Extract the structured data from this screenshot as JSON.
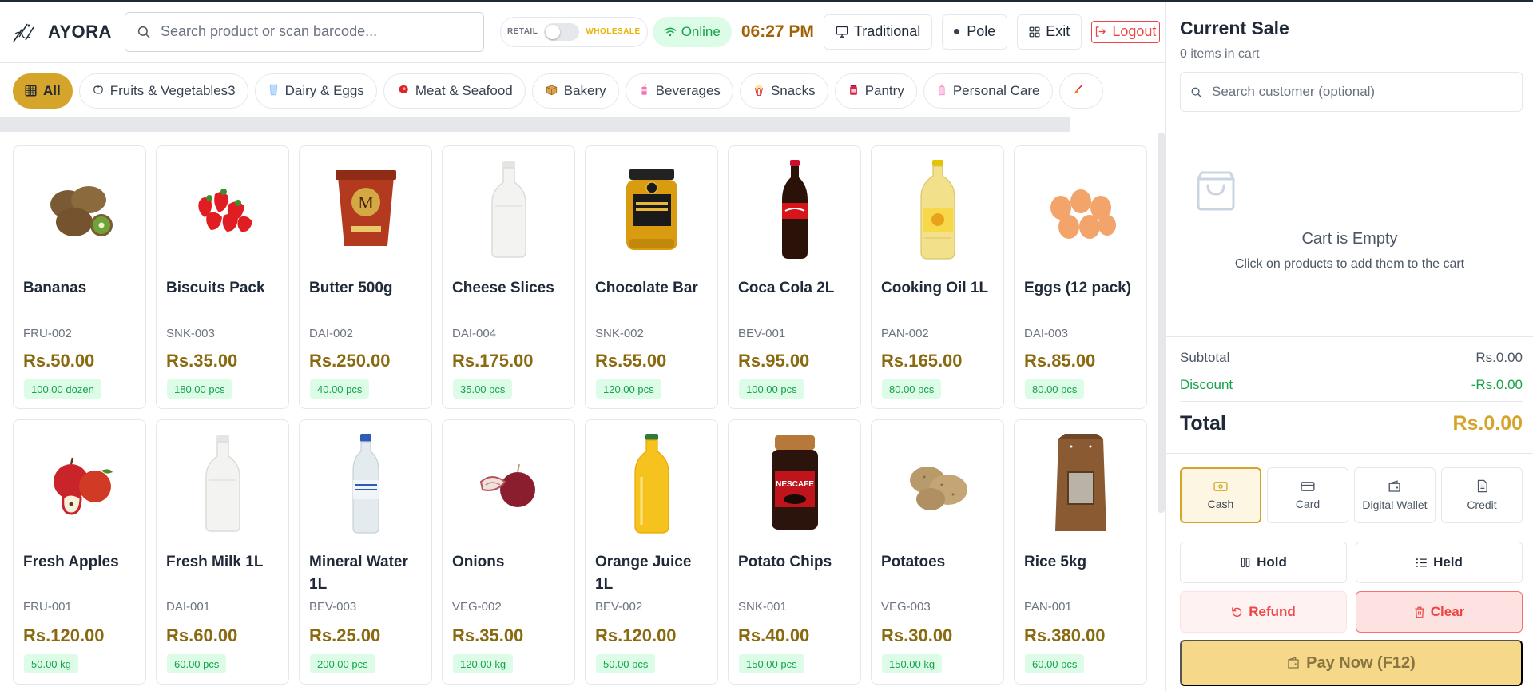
{
  "app": {
    "brand": "AYORA"
  },
  "header": {
    "search_placeholder": "Search product or scan barcode...",
    "mode_retail": "RETAIL",
    "mode_wholesale": "WHOLESALE",
    "status": "Online",
    "time": "06:27 PM",
    "btn_traditional": "Traditional",
    "btn_pole": "Pole",
    "btn_exit": "Exit",
    "btn_logout": "Logout"
  },
  "categories": [
    {
      "label": "All",
      "icon": "grid-icon",
      "active": true
    },
    {
      "label": "Fruits & Vegetables3",
      "icon": "apple-icon"
    },
    {
      "label": "Dairy & Eggs",
      "icon": "cup-icon"
    },
    {
      "label": "Meat & Seafood",
      "icon": "meat-icon"
    },
    {
      "label": "Bakery",
      "icon": "box-icon"
    },
    {
      "label": "Beverages",
      "icon": "drink-icon"
    },
    {
      "label": "Snacks",
      "icon": "popcorn-icon"
    },
    {
      "label": "Pantry",
      "icon": "jar-icon"
    },
    {
      "label": "Personal Care",
      "icon": "bottle-icon"
    }
  ],
  "products": [
    {
      "name": "Bananas",
      "sku": "FRU-002",
      "price": "Rs.50.00",
      "stock": "100.00 dozen",
      "image": "kiwi-image"
    },
    {
      "name": "Biscuits Pack",
      "sku": "SNK-003",
      "price": "Rs.35.00",
      "stock": "180.00 pcs",
      "image": "strawberries-image"
    },
    {
      "name": "Butter 500g",
      "sku": "DAI-002",
      "price": "Rs.250.00",
      "stock": "40.00 pcs",
      "image": "ice-cream-tub-image"
    },
    {
      "name": "Cheese Slices",
      "sku": "DAI-004",
      "price": "Rs.175.00",
      "stock": "35.00 pcs",
      "image": "milk-bottle-image"
    },
    {
      "name": "Chocolate Bar",
      "sku": "SNK-002",
      "price": "Rs.55.00",
      "stock": "120.00 pcs",
      "image": "honey-jar-image"
    },
    {
      "name": "Coca Cola 2L",
      "sku": "BEV-001",
      "price": "Rs.95.00",
      "stock": "100.00 pcs",
      "image": "cola-bottle-image"
    },
    {
      "name": "Cooking Oil 1L",
      "sku": "PAN-002",
      "price": "Rs.165.00",
      "stock": "80.00 pcs",
      "image": "oil-bottle-image"
    },
    {
      "name": "Eggs (12 pack)",
      "sku": "DAI-003",
      "price": "Rs.85.00",
      "stock": "80.00 pcs",
      "image": "eggs-image"
    },
    {
      "name": "Fresh Apples",
      "sku": "FRU-001",
      "price": "Rs.120.00",
      "stock": "50.00 kg",
      "image": "apples-image"
    },
    {
      "name": "Fresh Milk 1L",
      "sku": "DAI-001",
      "price": "Rs.60.00",
      "stock": "60.00 pcs",
      "image": "milk-bottle-image"
    },
    {
      "name": "Mineral Water 1L",
      "sku": "BEV-003",
      "price": "Rs.25.00",
      "stock": "200.00 pcs",
      "image": "water-bottle-image"
    },
    {
      "name": "Onions",
      "sku": "VEG-002",
      "price": "Rs.35.00",
      "stock": "120.00 kg",
      "image": "onions-image"
    },
    {
      "name": "Orange Juice 1L",
      "sku": "BEV-002",
      "price": "Rs.120.00",
      "stock": "50.00 pcs",
      "image": "juice-bottle-image"
    },
    {
      "name": "Potato Chips",
      "sku": "SNK-001",
      "price": "Rs.40.00",
      "stock": "150.00 pcs",
      "image": "coffee-jar-image"
    },
    {
      "name": "Potatoes",
      "sku": "VEG-003",
      "price": "Rs.30.00",
      "stock": "150.00 kg",
      "image": "potatoes-image"
    },
    {
      "name": "Rice 5kg",
      "sku": "PAN-001",
      "price": "Rs.380.00",
      "stock": "60.00 pcs",
      "image": "paper-bag-image"
    }
  ],
  "cart": {
    "title": "Current Sale",
    "count_text": "0 items in cart",
    "customer_placeholder": "Search customer (optional)",
    "empty_title": "Cart is Empty",
    "empty_sub": "Click on products to add them to the cart",
    "subtotal_label": "Subtotal",
    "subtotal_value": "Rs.0.00",
    "discount_label": "Discount",
    "discount_value": "-Rs.0.00",
    "total_label": "Total",
    "total_value": "Rs.0.00"
  },
  "payment_methods": [
    {
      "label": "Cash",
      "icon": "cash-icon",
      "active": true
    },
    {
      "label": "Card",
      "icon": "card-icon"
    },
    {
      "label": "Digital Wallet",
      "icon": "wallet-icon"
    },
    {
      "label": "Credit",
      "icon": "document-icon"
    }
  ],
  "actions": {
    "hold": "Hold",
    "held": "Held",
    "refund": "Refund",
    "clear": "Clear",
    "pay_now": "Pay Now (F12)"
  },
  "colors": {
    "accent_gold": "#d4a52a",
    "price_brown": "#8a6a10",
    "online_green": "#16a34a",
    "danger_red": "#ef4444"
  }
}
